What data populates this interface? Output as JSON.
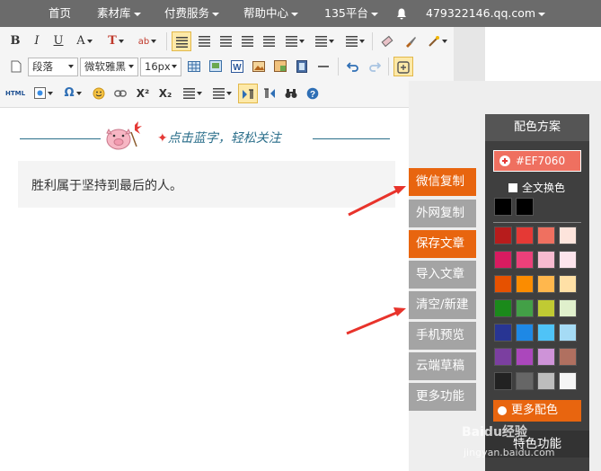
{
  "nav": {
    "home": "首页",
    "materials": "素材库",
    "paid": "付费服务",
    "help": "帮助中心",
    "platform": "135平台",
    "account": "479322146.qq.com"
  },
  "toolbar": {
    "bold": "B",
    "italic": "I",
    "underline": "U",
    "font_color": "A",
    "bg_color": "T",
    "paragraph": "段落",
    "font_family": "微软雅黑",
    "font_size": "16px",
    "html": "HTML",
    "omega": "Ω",
    "superscript": "X²",
    "subscript": "X₂"
  },
  "editor": {
    "banner": "点击蓝字，轻松关注",
    "content": "胜利属于坚持到最后的人。"
  },
  "side_buttons": [
    {
      "label": "微信复制"
    },
    {
      "label": "外网复制"
    },
    {
      "label": "保存文章"
    },
    {
      "label": "导入文章"
    },
    {
      "label": "清空/新建"
    },
    {
      "label": "手机预览"
    },
    {
      "label": "云端草稿"
    },
    {
      "label": "更多功能"
    }
  ],
  "color_panel": {
    "title": "配色方案",
    "hex": "#EF7060",
    "full_text_label": "全文换色",
    "more_colors": "更多配色",
    "special": "特色功能",
    "swatches": [
      [
        "#b71c1c",
        "#e53935",
        "#ef7060",
        "#fde4dc"
      ],
      [
        "#d81b60",
        "#ec407a",
        "#f8bbd0",
        "#fce4ec"
      ],
      [
        "#e65100",
        "#fb8c00",
        "#ffb74d",
        "#ffe0a6"
      ],
      [
        "#1b8a1b",
        "#43a047",
        "#c0ca33",
        "#e0f0cc"
      ],
      [
        "#283593",
        "#1e88e5",
        "#4fc3f7",
        "#a5dbf5"
      ],
      [
        "#7b3fa0",
        "#ab47bc",
        "#ce93d8",
        "#b07060"
      ],
      [
        "#222222",
        "#666666",
        "#bdbdbd",
        "#f5f5f5"
      ]
    ],
    "selected_swatches": [
      "#000000",
      "#000000"
    ]
  },
  "watermark": {
    "main": "Baidu经验",
    "sub": "jingyan.baidu.com"
  }
}
